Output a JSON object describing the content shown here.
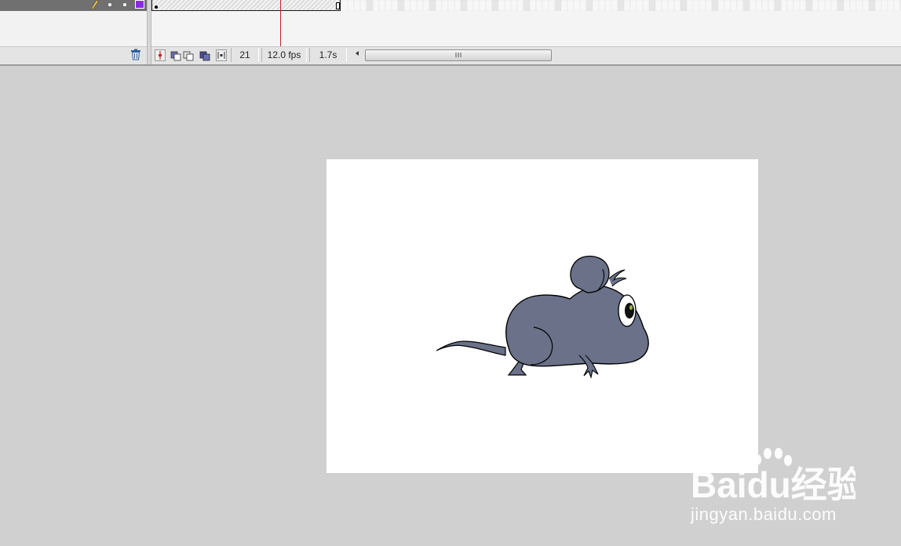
{
  "timeline": {
    "current_frame": "21",
    "frame_rate": "12.0 fps",
    "elapsed_time": "1.7s",
    "layer_color": "#8a2be2",
    "playhead_color": "#c0282e",
    "icons": {
      "edit": "pencil-icon",
      "delete": "trash-icon",
      "center_frame": "center-frame-icon",
      "onion_skin": "onion-skin-icon",
      "onion_outlines": "onion-skin-outlines-icon",
      "edit_multiple": "edit-multiple-frames-icon",
      "onion_markers": "onion-markers-icon"
    }
  },
  "stage": {
    "background_color": "#ffffff",
    "workspace_color": "#d0d0d0",
    "mouse_fill_color": "#6a7189"
  },
  "watermark": {
    "logo_text": "Baidu经验",
    "url": "jingyan.baidu.com"
  }
}
